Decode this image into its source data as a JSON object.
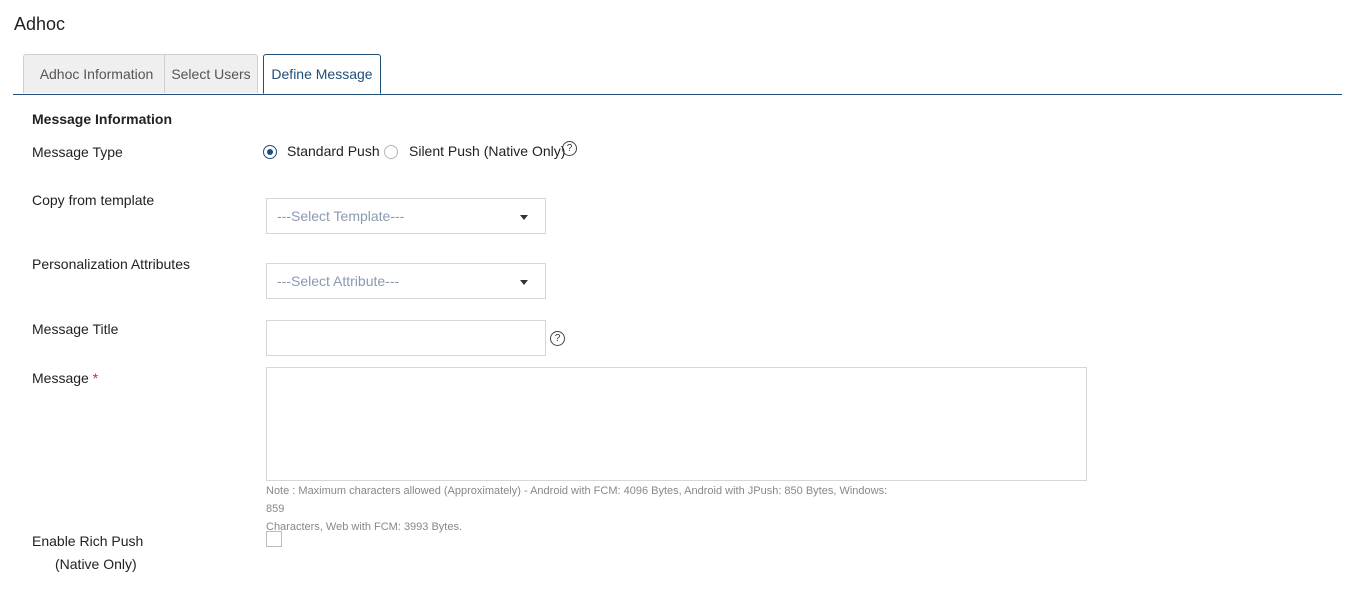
{
  "page": {
    "title": "Adhoc"
  },
  "tabs": [
    {
      "label": "Adhoc Information",
      "active": false
    },
    {
      "label": "Select Users",
      "active": false
    },
    {
      "label": "Define Message",
      "active": true
    }
  ],
  "form": {
    "section_title": "Message Information",
    "message_type": {
      "label": "Message Type",
      "options": [
        {
          "label": "Standard Push",
          "checked": true
        },
        {
          "label": "Silent Push (Native Only)",
          "checked": false
        }
      ],
      "help": "?"
    },
    "copy_template": {
      "label": "Copy from template",
      "placeholder": "---Select Template---"
    },
    "personalization": {
      "label": "Personalization Attributes",
      "placeholder": "---Select Attribute---"
    },
    "message_title": {
      "label": "Message Title",
      "value": "",
      "help": "?"
    },
    "message": {
      "label": "Message",
      "required_mark": "*",
      "value": "",
      "note_line1": "Note : Maximum characters allowed (Approximately) - Android with FCM: 4096 Bytes, Android with JPush: 850 Bytes, Windows: 859",
      "note_line2": "Characters, Web with FCM: 3993 Bytes."
    },
    "rich_push": {
      "label_line1": "Enable Rich Push",
      "label_line2": "(Native Only)",
      "checked": false
    }
  },
  "colors": {
    "accent": "#1f4e79",
    "required": "#d9262c",
    "placeholder": "#8a9bb0"
  },
  "icons": {
    "help": "question-circle-icon",
    "caret": "caret-down-icon"
  }
}
